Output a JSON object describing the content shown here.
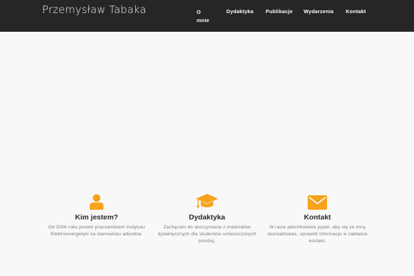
{
  "site": {
    "title": "Przemysław Tabaka"
  },
  "nav": {
    "items": [
      {
        "label": "O mnie"
      },
      {
        "label": "Dydaktyka"
      },
      {
        "label": "Publikacje"
      },
      {
        "label": "Wydarzenia"
      },
      {
        "label": "Kontakt"
      }
    ]
  },
  "colors": {
    "accent": "#f7a21b",
    "header_bg": "#262626",
    "page_bg": "#f8f8f8"
  },
  "features": [
    {
      "icon": "user-icon",
      "title": "Kim jestem?",
      "text": "Od 2006 roku jestem pracownikiem Instytutu Elektroenergetyki na stanowisku adiunkta."
    },
    {
      "icon": "graduation-cap-icon",
      "title": "Dydaktyka",
      "text": "Zachęcam do skorzystania z materiałów dydaktycznych dla studentów umieszczonych poniżej."
    },
    {
      "icon": "envelope-icon",
      "title": "Kontakt",
      "text": "W razie jakichkolwiek pytań, aby się ze mną skontaktować, sprawdź informacje w zakładce kontakt."
    }
  ]
}
